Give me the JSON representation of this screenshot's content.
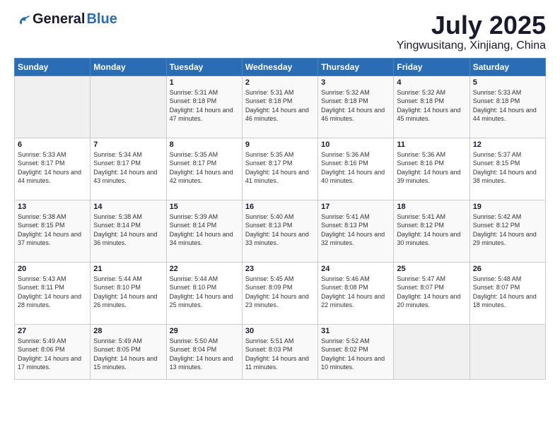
{
  "logo": {
    "general": "General",
    "blue": "Blue"
  },
  "title": {
    "month": "July 2025",
    "location": "Yingwusitang, Xinjiang, China"
  },
  "weekdays": [
    "Sunday",
    "Monday",
    "Tuesday",
    "Wednesday",
    "Thursday",
    "Friday",
    "Saturday"
  ],
  "weeks": [
    [
      {
        "day": "",
        "info": ""
      },
      {
        "day": "",
        "info": ""
      },
      {
        "day": "1",
        "info": "Sunrise: 5:31 AM\nSunset: 8:18 PM\nDaylight: 14 hours and 47 minutes."
      },
      {
        "day": "2",
        "info": "Sunrise: 5:31 AM\nSunset: 8:18 PM\nDaylight: 14 hours and 46 minutes."
      },
      {
        "day": "3",
        "info": "Sunrise: 5:32 AM\nSunset: 8:18 PM\nDaylight: 14 hours and 46 minutes."
      },
      {
        "day": "4",
        "info": "Sunrise: 5:32 AM\nSunset: 8:18 PM\nDaylight: 14 hours and 45 minutes."
      },
      {
        "day": "5",
        "info": "Sunrise: 5:33 AM\nSunset: 8:18 PM\nDaylight: 14 hours and 44 minutes."
      }
    ],
    [
      {
        "day": "6",
        "info": "Sunrise: 5:33 AM\nSunset: 8:17 PM\nDaylight: 14 hours and 44 minutes."
      },
      {
        "day": "7",
        "info": "Sunrise: 5:34 AM\nSunset: 8:17 PM\nDaylight: 14 hours and 43 minutes."
      },
      {
        "day": "8",
        "info": "Sunrise: 5:35 AM\nSunset: 8:17 PM\nDaylight: 14 hours and 42 minutes."
      },
      {
        "day": "9",
        "info": "Sunrise: 5:35 AM\nSunset: 8:17 PM\nDaylight: 14 hours and 41 minutes."
      },
      {
        "day": "10",
        "info": "Sunrise: 5:36 AM\nSunset: 8:16 PM\nDaylight: 14 hours and 40 minutes."
      },
      {
        "day": "11",
        "info": "Sunrise: 5:36 AM\nSunset: 8:16 PM\nDaylight: 14 hours and 39 minutes."
      },
      {
        "day": "12",
        "info": "Sunrise: 5:37 AM\nSunset: 8:15 PM\nDaylight: 14 hours and 38 minutes."
      }
    ],
    [
      {
        "day": "13",
        "info": "Sunrise: 5:38 AM\nSunset: 8:15 PM\nDaylight: 14 hours and 37 minutes."
      },
      {
        "day": "14",
        "info": "Sunrise: 5:38 AM\nSunset: 8:14 PM\nDaylight: 14 hours and 36 minutes."
      },
      {
        "day": "15",
        "info": "Sunrise: 5:39 AM\nSunset: 8:14 PM\nDaylight: 14 hours and 34 minutes."
      },
      {
        "day": "16",
        "info": "Sunrise: 5:40 AM\nSunset: 8:13 PM\nDaylight: 14 hours and 33 minutes."
      },
      {
        "day": "17",
        "info": "Sunrise: 5:41 AM\nSunset: 8:13 PM\nDaylight: 14 hours and 32 minutes."
      },
      {
        "day": "18",
        "info": "Sunrise: 5:41 AM\nSunset: 8:12 PM\nDaylight: 14 hours and 30 minutes."
      },
      {
        "day": "19",
        "info": "Sunrise: 5:42 AM\nSunset: 8:12 PM\nDaylight: 14 hours and 29 minutes."
      }
    ],
    [
      {
        "day": "20",
        "info": "Sunrise: 5:43 AM\nSunset: 8:11 PM\nDaylight: 14 hours and 28 minutes."
      },
      {
        "day": "21",
        "info": "Sunrise: 5:44 AM\nSunset: 8:10 PM\nDaylight: 14 hours and 26 minutes."
      },
      {
        "day": "22",
        "info": "Sunrise: 5:44 AM\nSunset: 8:10 PM\nDaylight: 14 hours and 25 minutes."
      },
      {
        "day": "23",
        "info": "Sunrise: 5:45 AM\nSunset: 8:09 PM\nDaylight: 14 hours and 23 minutes."
      },
      {
        "day": "24",
        "info": "Sunrise: 5:46 AM\nSunset: 8:08 PM\nDaylight: 14 hours and 22 minutes."
      },
      {
        "day": "25",
        "info": "Sunrise: 5:47 AM\nSunset: 8:07 PM\nDaylight: 14 hours and 20 minutes."
      },
      {
        "day": "26",
        "info": "Sunrise: 5:48 AM\nSunset: 8:07 PM\nDaylight: 14 hours and 18 minutes."
      }
    ],
    [
      {
        "day": "27",
        "info": "Sunrise: 5:49 AM\nSunset: 8:06 PM\nDaylight: 14 hours and 17 minutes."
      },
      {
        "day": "28",
        "info": "Sunrise: 5:49 AM\nSunset: 8:05 PM\nDaylight: 14 hours and 15 minutes."
      },
      {
        "day": "29",
        "info": "Sunrise: 5:50 AM\nSunset: 8:04 PM\nDaylight: 14 hours and 13 minutes."
      },
      {
        "day": "30",
        "info": "Sunrise: 5:51 AM\nSunset: 8:03 PM\nDaylight: 14 hours and 11 minutes."
      },
      {
        "day": "31",
        "info": "Sunrise: 5:52 AM\nSunset: 8:02 PM\nDaylight: 14 hours and 10 minutes."
      },
      {
        "day": "",
        "info": ""
      },
      {
        "day": "",
        "info": ""
      }
    ]
  ]
}
